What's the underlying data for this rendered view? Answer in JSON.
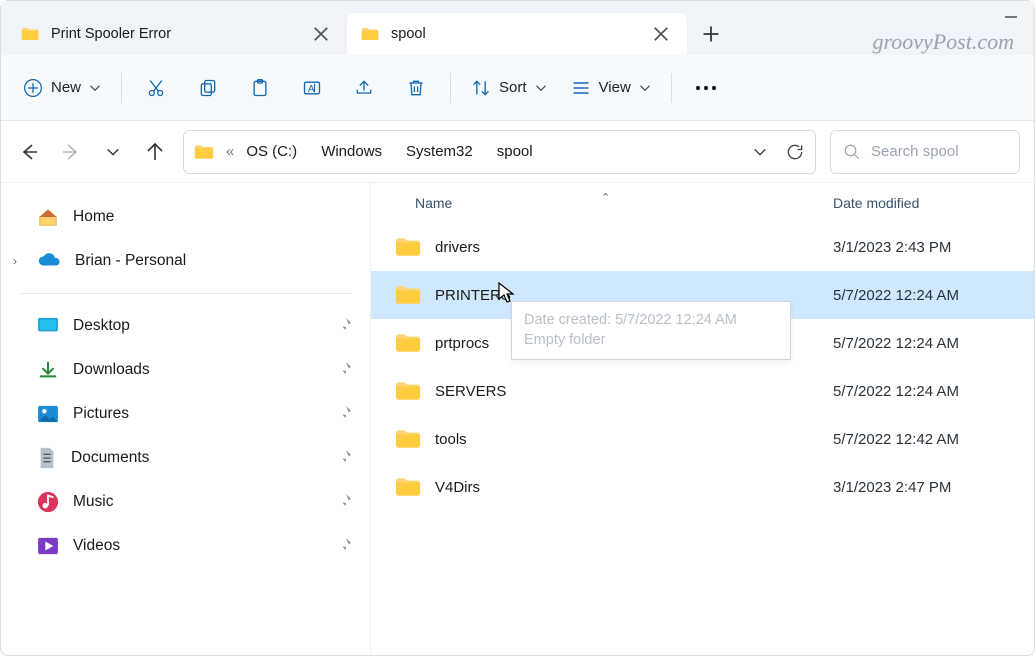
{
  "tabs": [
    {
      "title": "Print Spooler Error",
      "active": false
    },
    {
      "title": "spool",
      "active": true
    }
  ],
  "watermark": "groovyPost.com",
  "toolbar": {
    "new_label": "New",
    "sort_label": "Sort",
    "view_label": "View"
  },
  "breadcrumb": {
    "prefix": "«",
    "segments": [
      "OS (C:)",
      "Windows",
      "System32",
      "spool"
    ]
  },
  "search": {
    "placeholder": "Search spool"
  },
  "sidebar": {
    "home": "Home",
    "cloud": "Brian - Personal",
    "quick": [
      {
        "label": "Desktop",
        "icon": "desktop"
      },
      {
        "label": "Downloads",
        "icon": "downloads"
      },
      {
        "label": "Pictures",
        "icon": "pictures"
      },
      {
        "label": "Documents",
        "icon": "documents"
      },
      {
        "label": "Music",
        "icon": "music"
      },
      {
        "label": "Videos",
        "icon": "videos"
      }
    ]
  },
  "columns": {
    "name": "Name",
    "date": "Date modified"
  },
  "files": [
    {
      "name": "drivers",
      "date": "3/1/2023 2:43 PM",
      "selected": false
    },
    {
      "name": "PRINTERS",
      "date": "5/7/2022 12:24 AM",
      "selected": true
    },
    {
      "name": "prtprocs",
      "date": "5/7/2022 12:24 AM",
      "selected": false
    },
    {
      "name": "SERVERS",
      "date": "5/7/2022 12:24 AM",
      "selected": false
    },
    {
      "name": "tools",
      "date": "5/7/2022 12:42 AM",
      "selected": false
    },
    {
      "name": "V4Dirs",
      "date": "3/1/2023 2:47 PM",
      "selected": false
    }
  ],
  "tooltip": {
    "line1": "Date created: 5/7/2022 12:24 AM",
    "line2": "Empty folder"
  }
}
